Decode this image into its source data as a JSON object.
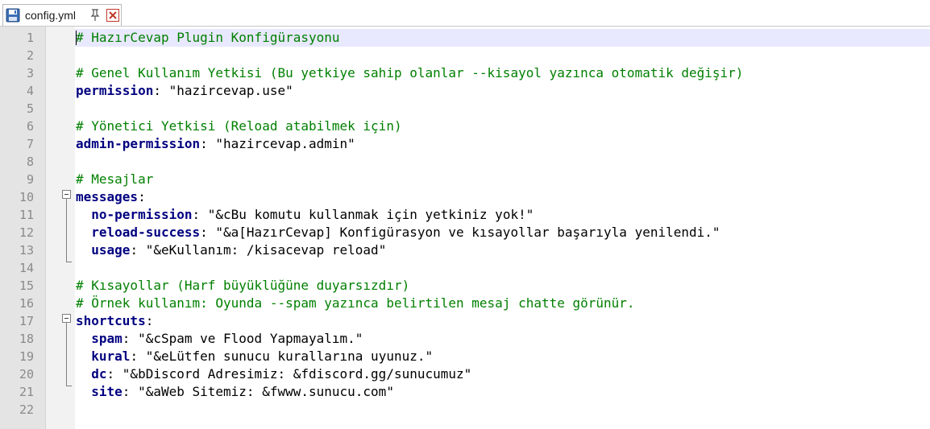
{
  "tab": {
    "title": "config.yml"
  },
  "lines": [
    {
      "num": "1",
      "parts": [
        {
          "t": "cm",
          "v": "# HazırCevap Plugin Konfigürasyonu"
        }
      ]
    },
    {
      "num": "2",
      "parts": []
    },
    {
      "num": "3",
      "parts": [
        {
          "t": "cm",
          "v": "# Genel Kullanım Yetkisi (Bu yetkiye sahip olanlar --kisayol yazınca otomatik değişir)"
        }
      ]
    },
    {
      "num": "4",
      "parts": [
        {
          "t": "key",
          "v": "permission"
        },
        {
          "t": "str",
          "v": ": \"hazircevap.use\""
        }
      ]
    },
    {
      "num": "5",
      "parts": []
    },
    {
      "num": "6",
      "parts": [
        {
          "t": "cm",
          "v": "# Yönetici Yetkisi (Reload atabilmek için)"
        }
      ]
    },
    {
      "num": "7",
      "parts": [
        {
          "t": "key",
          "v": "admin-permission"
        },
        {
          "t": "str",
          "v": ": \"hazircevap.admin\""
        }
      ]
    },
    {
      "num": "8",
      "parts": []
    },
    {
      "num": "9",
      "parts": [
        {
          "t": "cm",
          "v": "# Mesajlar"
        }
      ]
    },
    {
      "num": "10",
      "parts": [
        {
          "t": "key",
          "v": "messages"
        },
        {
          "t": "str",
          "v": ":"
        }
      ]
    },
    {
      "num": "11",
      "parts": [
        {
          "t": "str",
          "v": "  "
        },
        {
          "t": "key",
          "v": "no-permission"
        },
        {
          "t": "str",
          "v": ": \"&cBu komutu kullanmak için yetkiniz yok!\""
        }
      ]
    },
    {
      "num": "12",
      "parts": [
        {
          "t": "str",
          "v": "  "
        },
        {
          "t": "key",
          "v": "reload-success"
        },
        {
          "t": "str",
          "v": ": \"&a[HazırCevap] Konfigürasyon ve kısayollar başarıyla yenilendi.\""
        }
      ]
    },
    {
      "num": "13",
      "parts": [
        {
          "t": "str",
          "v": "  "
        },
        {
          "t": "key",
          "v": "usage"
        },
        {
          "t": "str",
          "v": ": \"&eKullanım: /kisacevap reload\""
        }
      ]
    },
    {
      "num": "14",
      "parts": []
    },
    {
      "num": "15",
      "parts": [
        {
          "t": "cm",
          "v": "# Kısayollar (Harf büyüklüğüne duyarsızdır)"
        }
      ]
    },
    {
      "num": "16",
      "parts": [
        {
          "t": "cm",
          "v": "# Örnek kullanım: Oyunda --spam yazınca belirtilen mesaj chatte görünür."
        }
      ]
    },
    {
      "num": "17",
      "parts": [
        {
          "t": "key",
          "v": "shortcuts"
        },
        {
          "t": "str",
          "v": ":"
        }
      ]
    },
    {
      "num": "18",
      "parts": [
        {
          "t": "str",
          "v": "  "
        },
        {
          "t": "key",
          "v": "spam"
        },
        {
          "t": "str",
          "v": ": \"&cSpam ve Flood Yapmayalım.\""
        }
      ]
    },
    {
      "num": "19",
      "parts": [
        {
          "t": "str",
          "v": "  "
        },
        {
          "t": "key",
          "v": "kural"
        },
        {
          "t": "str",
          "v": ": \"&eLütfen sunucu kurallarına uyunuz.\""
        }
      ]
    },
    {
      "num": "20",
      "parts": [
        {
          "t": "str",
          "v": "  "
        },
        {
          "t": "key",
          "v": "dc"
        },
        {
          "t": "str",
          "v": ": \"&bDiscord Adresimiz: &fdiscord.gg/sunucumuz\""
        }
      ]
    },
    {
      "num": "21",
      "parts": [
        {
          "t": "str",
          "v": "  "
        },
        {
          "t": "key",
          "v": "site"
        },
        {
          "t": "str",
          "v": ": \"&aWeb Sitemiz: &fwww.sunucu.com\""
        }
      ]
    },
    {
      "num": "22",
      "parts": []
    }
  ]
}
